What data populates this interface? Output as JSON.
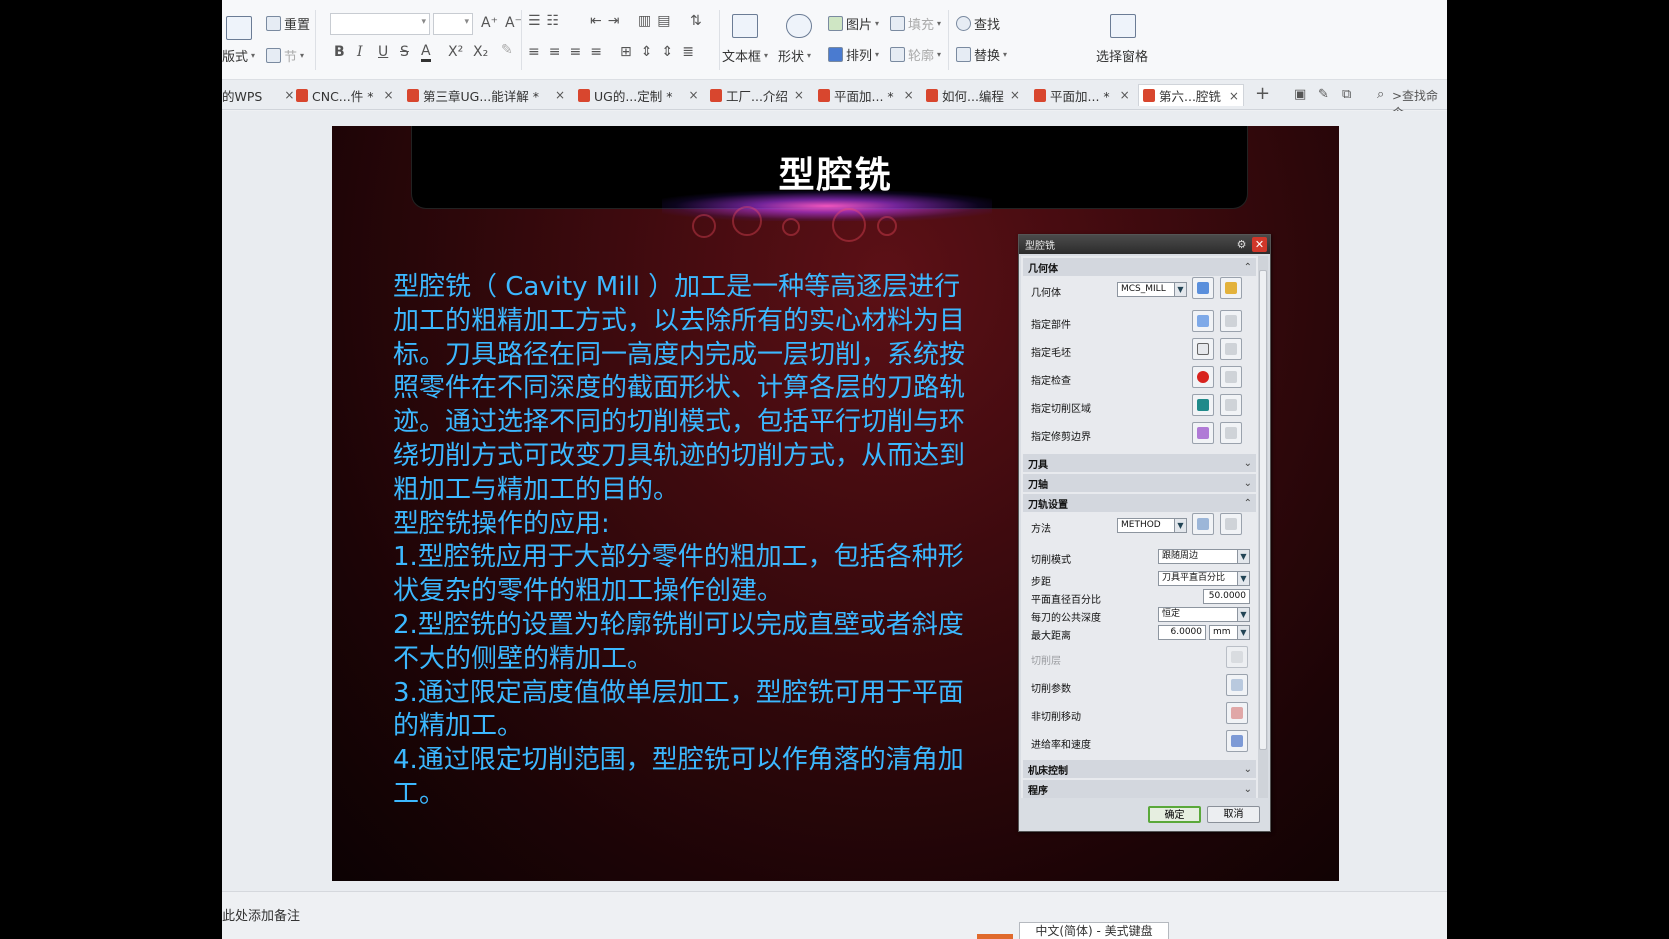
{
  "ribbon": {
    "reset": "重置",
    "layout": "版式",
    "section": "节",
    "bold": "B",
    "italic": "I",
    "underline": "U",
    "strike": "S",
    "fontcolor": "A",
    "superscript": "X²",
    "subscript": "X₂",
    "grow_font": "A⁺",
    "shrink_font": "A⁻",
    "textbox": "文本框",
    "shape": "形状",
    "picture": "图片",
    "arrange": "排列",
    "fill": "填充",
    "outline": "轮廓",
    "find": "查找",
    "replace": "替换",
    "select_pane": "选择窗格"
  },
  "tabs": [
    {
      "label": "的WPS",
      "close": "×"
    },
    {
      "label": "CNC...件 *",
      "close": "×"
    },
    {
      "label": "第三章UG...能详解 *",
      "close": "×"
    },
    {
      "label": "UG的...定制 *",
      "close": "×"
    },
    {
      "label": "工厂...介绍",
      "close": "×"
    },
    {
      "label": "平面加... *",
      "close": "×"
    },
    {
      "label": "如何...编程",
      "close": "×"
    },
    {
      "label": "平面加... *",
      "close": "×"
    },
    {
      "label": "第六...腔铣",
      "close": "×"
    }
  ],
  "tab_tools": {
    "add": "+",
    "search_cmd": ">查找命令"
  },
  "slide": {
    "title": "型腔铣",
    "paragraphs": [
      "型腔铣（ Cavity Mill ）加工是一种等高逐层进行加工的粗精加工方式，以去除所有的实心材料为目标。刀具路径在同一高度内完成一层切削，系统按照零件在不同深度的截面形状、计算各层的刀路轨迹。通过选择不同的切削模式，包括平行切削与环绕切削方式可改变刀具轨迹的切削方式，从而达到粗加工与精加工的目的。",
      "型腔铣操作的应用:",
      "1.型腔铣应用于大部分零件的粗加工，包括各种形状复杂的零件的粗加工操作创建。",
      "2.型腔铣的设置为轮廓铣削可以完成直壁或者斜度不大的侧壁的精加工。",
      "3.通过限定高度值做单层加工，型腔铣可用于平面的精加工。",
      "4.通过限定切削范围，型腔铣可以作角落的清角加工。"
    ]
  },
  "dialog": {
    "title": "型腔铣",
    "sections": {
      "geometry": "几何体",
      "tool": "刀具",
      "axis": "刀轴",
      "path": "刀轨设置",
      "machine": "机床控制",
      "program": "程序"
    },
    "geometry_label": "几何体",
    "geometry_value": "MCS_MILL",
    "specify_part": "指定部件",
    "specify_blank": "指定毛坯",
    "specify_check": "指定检查",
    "specify_cut_area": "指定切削区域",
    "specify_trim": "指定修剪边界",
    "method_label": "方法",
    "method_value": "METHOD",
    "cut_pattern_label": "切削模式",
    "cut_pattern_value": "跟随周边",
    "stepover_label": "步距",
    "stepover_value": "刀具平直百分比",
    "flat_diameter_label": "平面直径百分比",
    "flat_diameter_value": "50.0000",
    "depth_label": "每刀的公共深度",
    "depth_value": "恒定",
    "max_distance_label": "最大距离",
    "max_distance_value": "6.0000",
    "unit_value": "mm",
    "cut_levels": "切削层",
    "cut_params": "切削参数",
    "non_cut_moves": "非切削移动",
    "feeds_speeds": "进给率和速度",
    "ok": "确定",
    "cancel": "取消"
  },
  "notes": "此处添加备注",
  "ime": "中文(简体) - 美式键盘"
}
